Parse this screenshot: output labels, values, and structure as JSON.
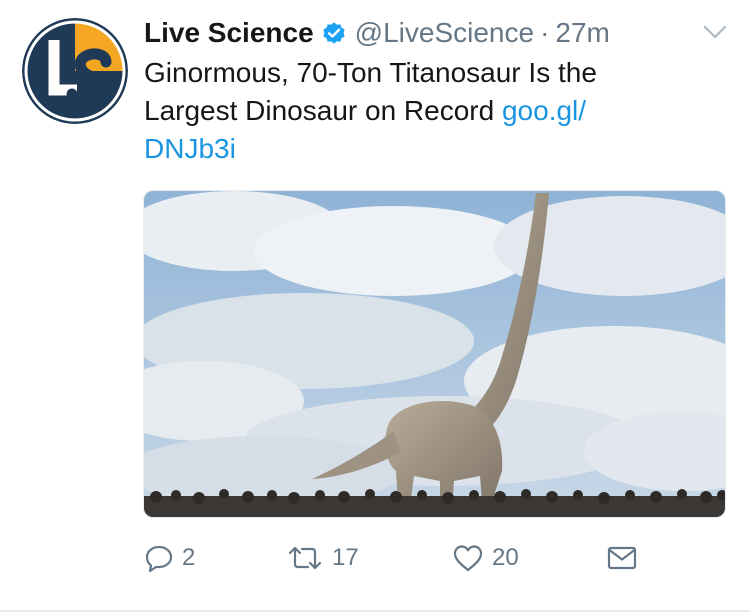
{
  "account": {
    "name": "Live Science",
    "handle": "@LiveScience",
    "separator": "·",
    "time": "27m",
    "avatar_initials": "LS",
    "verified": true
  },
  "tweet": {
    "text": "Ginormous, 70-Ton Titanosaur Is the Largest Dinosaur on Record ",
    "link_text": "goo.gl/​DNJb3i"
  },
  "media": {
    "description_icon": "photo"
  },
  "actions": {
    "reply_count": "2",
    "retweet_count": "17",
    "like_count": "20"
  },
  "colors": {
    "link": "#1b95e0",
    "secondary_text": "#657786",
    "avatar_bg": "#1f3a56",
    "avatar_accent": "#f5a623"
  }
}
